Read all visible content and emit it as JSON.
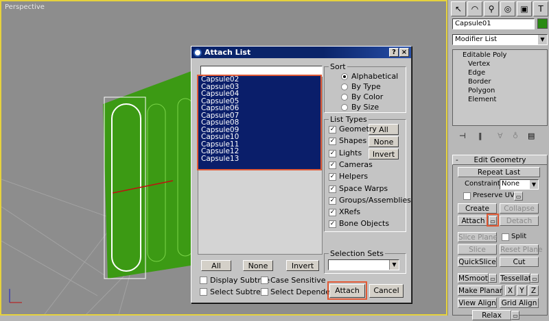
{
  "viewport": {
    "label": "Perspective"
  },
  "dialog": {
    "title": "Attach List",
    "help": "?",
    "close": "×",
    "filter_value": "",
    "objects": [
      "Capsule02",
      "Capsule03",
      "Capsule04",
      "Capsule05",
      "Capsule06",
      "Capsule07",
      "Capsule08",
      "Capsule09",
      "Capsule10",
      "Capsule11",
      "Capsule12",
      "Capsule13"
    ],
    "sort": {
      "title": "Sort",
      "options": [
        "Alphabetical",
        "By Type",
        "By Color",
        "By Size"
      ]
    },
    "list_types": {
      "title": "List Types",
      "items": [
        "Geometry",
        "Shapes",
        "Lights",
        "Cameras",
        "Helpers",
        "Space Warps",
        "Groups/Assemblies",
        "XRefs",
        "Bone Objects"
      ],
      "all": "All",
      "none": "None",
      "invert": "Invert"
    },
    "selection_sets": {
      "title": "Selection Sets"
    },
    "bottom": {
      "all": "All",
      "none": "None",
      "invert": "Invert"
    },
    "options": {
      "display_subtree": "Display Subtree",
      "case_sensitive": "Case Sensitive",
      "select_subtree": "Select Subtree",
      "select_dependents": "Select Dependents"
    },
    "attach": "Attach",
    "cancel": "Cancel"
  },
  "panel": {
    "object_name": "Capsule01",
    "object_color": "#2a8a12",
    "modifier_list": "Modifier List",
    "stack": [
      "Editable Poly",
      "Vertex",
      "Edge",
      "Border",
      "Polygon",
      "Element"
    ],
    "rollout_title": "Edit Geometry",
    "rollout_toggle": "-",
    "repeat_last": "Repeat Last",
    "constraints_label": "Constraints:",
    "constraints_value": "None",
    "preserve_uvs": "Preserve UVs",
    "create": "Create",
    "collapse": "Collapse",
    "attach": "Attach",
    "detach": "Detach",
    "slice_plane": "Slice Plane",
    "split": "Split",
    "slice": "Slice",
    "reset_plane": "Reset Plane",
    "quickslice": "QuickSlice",
    "cut": "Cut",
    "msmooth": "MSmooth",
    "tessellate": "Tessellate",
    "make_planar": "Make Planar",
    "x": "X",
    "y": "Y",
    "z": "Z",
    "view_align": "View Align",
    "grid_align": "Grid Align",
    "relax": "Relax"
  }
}
